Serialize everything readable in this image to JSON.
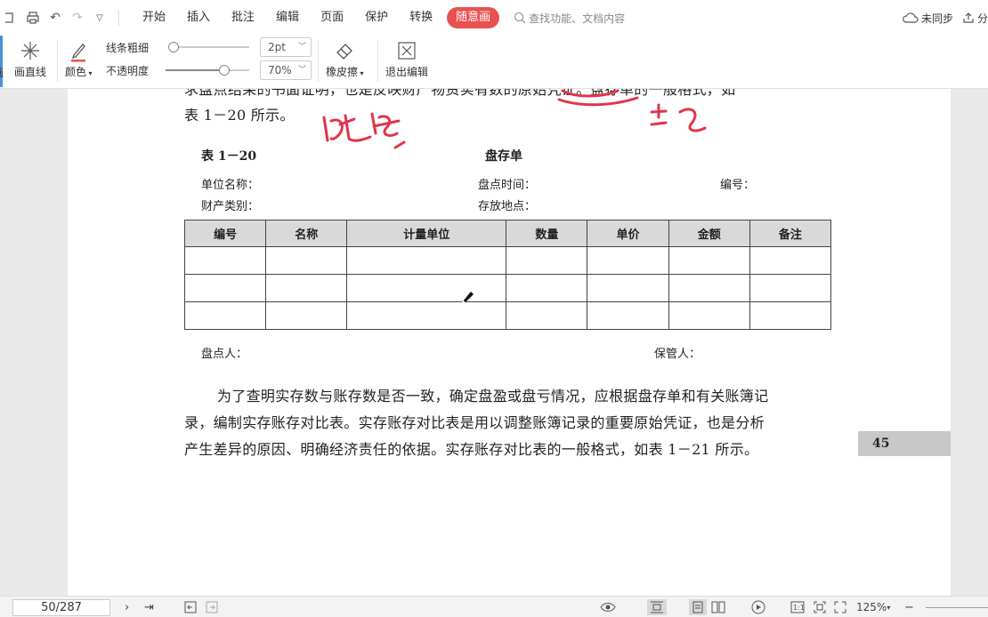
{
  "menubar": {
    "tabs": [
      {
        "label": "开始"
      },
      {
        "label": "插入"
      },
      {
        "label": "批注"
      },
      {
        "label": "编辑"
      },
      {
        "label": "页面"
      },
      {
        "label": "保护"
      },
      {
        "label": "转换"
      }
    ],
    "active_tab": "随意画",
    "search_placeholder": "查找功能、文档内容",
    "sync_label": "未同步",
    "share_label": "分"
  },
  "toolbar": {
    "edge_label": "画",
    "draw_line_label": "画直线",
    "color_label": "颜色",
    "line_width_label": "线条粗细",
    "line_width_value": "2pt",
    "opacity_label": "不透明度",
    "opacity_value": "70%",
    "opacity_level": 0.7,
    "eraser_label": "橡皮擦",
    "exit_label": "退出编辑",
    "accent_color": "#e8514f"
  },
  "document": {
    "top_line_partial": "求盘点结果的书面证明，也是反映财产物资实有数的原始凭证。盘存单的一般格式，如",
    "top_line_2": "表 1－20 所示。",
    "table_caption": "表 1－20",
    "table_title": "盘存单",
    "meta": {
      "unit_name": "单位名称：",
      "count_time": "盘点时间：",
      "number": "编号：",
      "asset_type": "财产类别：",
      "location": "存放地点："
    },
    "columns": [
      "编号",
      "名称",
      "计量单位",
      "数量",
      "单价",
      "金额",
      "备注"
    ],
    "empty_rows": 3,
    "counter": "盘点人：",
    "keeper": "保管人：",
    "paragraph": [
      "为了查明实存数与账存数是否一致，确定盘盈或盘亏情况，应根据盘存单和有关账簿记",
      "录，编制实存账存对比表。实存账存对比表是用以调整账簿记录的重要原始凭证，也是分析",
      "产生差异的原因、明确经济责任的依据。实存账存对比表的一般格式，如表 1－21 所示。"
    ],
    "page_number": "45"
  },
  "status": {
    "page_indicator": "50/287",
    "zoom": "125%"
  }
}
